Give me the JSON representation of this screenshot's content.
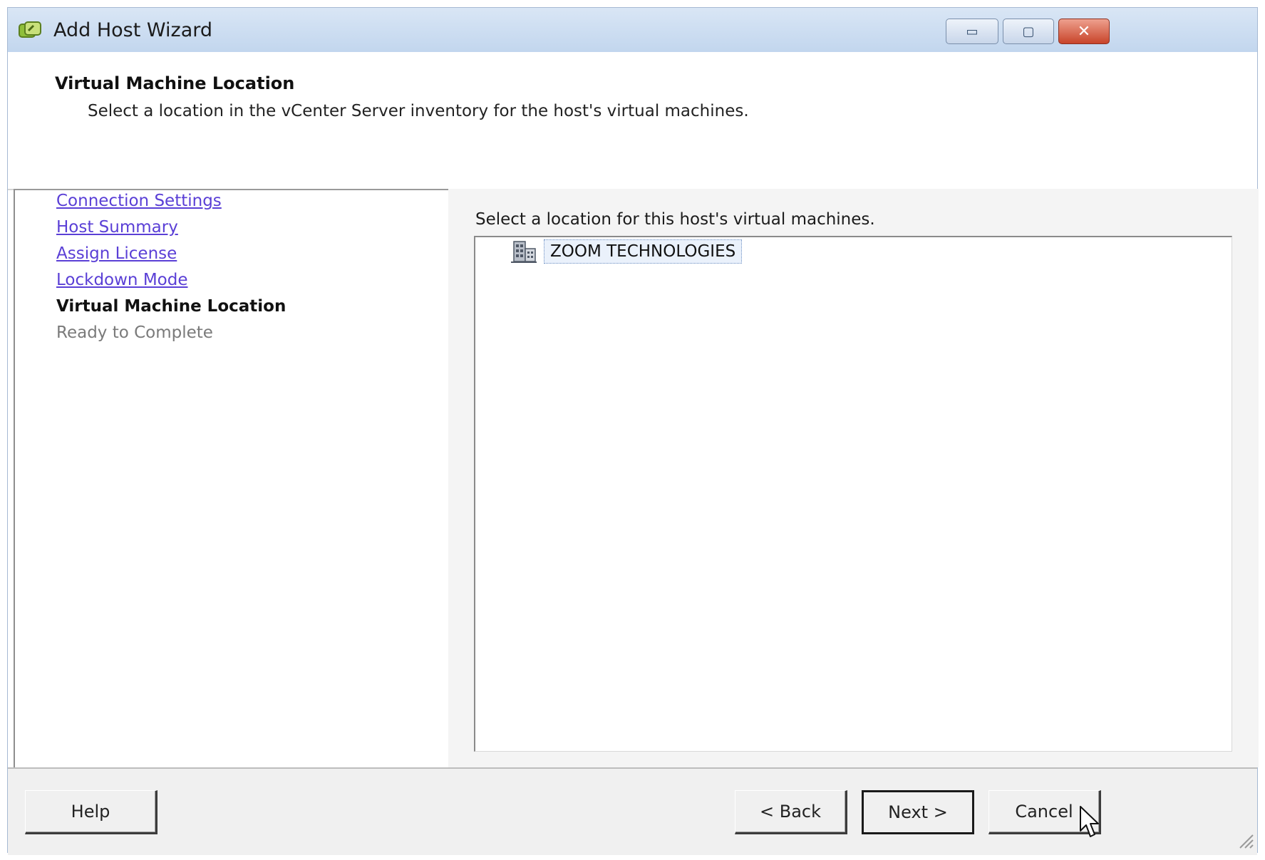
{
  "window": {
    "title": "Add Host Wizard",
    "icon": "wizard-app-icon",
    "controls": {
      "minimize": "▭",
      "maximize": "▢",
      "close": "✕"
    }
  },
  "header": {
    "title": "Virtual Machine Location",
    "description": "Select a location in the vCenter Server inventory for the host's virtual machines."
  },
  "steps": [
    {
      "label": "Connection Settings",
      "state": "completed"
    },
    {
      "label": "Host Summary",
      "state": "completed"
    },
    {
      "label": "Assign License",
      "state": "completed"
    },
    {
      "label": "Lockdown Mode",
      "state": "completed"
    },
    {
      "label": "Virtual Machine Location",
      "state": "current"
    },
    {
      "label": "Ready to Complete",
      "state": "pending"
    }
  ],
  "content": {
    "label": "Select a location for this host's virtual machines.",
    "tree": {
      "items": [
        {
          "label": "ZOOM TECHNOLOGIES",
          "icon": "datacenter-icon",
          "selected": true
        }
      ]
    }
  },
  "footer": {
    "help": "Help",
    "back": "< Back",
    "next": "Next >",
    "cancel": "Cancel"
  },
  "colors": {
    "link": "#5a3fd6",
    "titlebar": "#c2d6ee",
    "close_button": "#c8442a"
  }
}
